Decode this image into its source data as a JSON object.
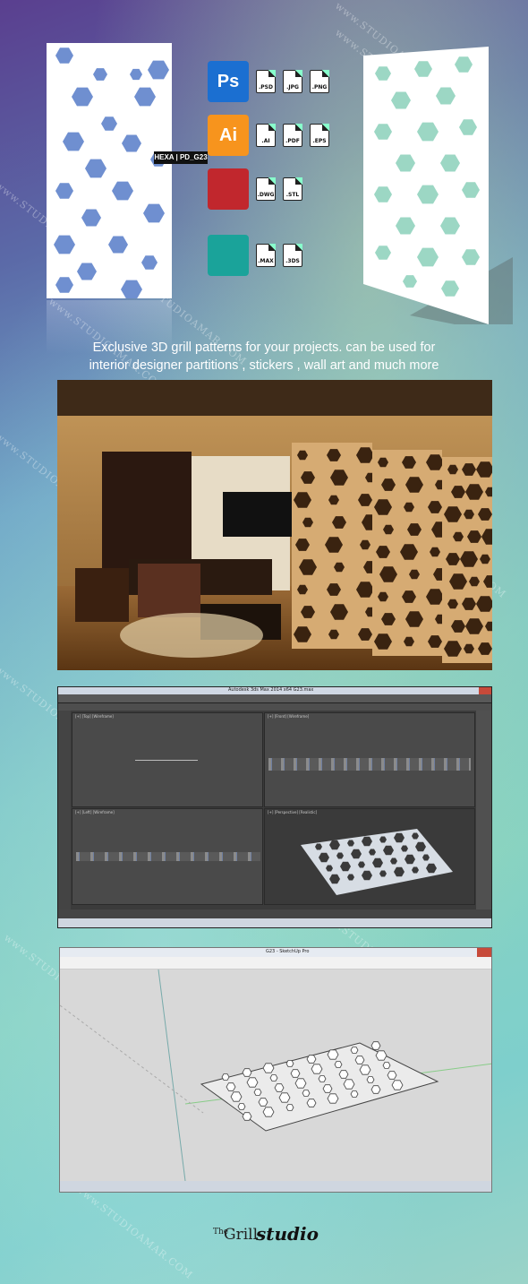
{
  "product_code": "HEXA | PD_G23",
  "watermark": "www.STUDIOAMAR.COM",
  "formats": [
    {
      "app": "ps-icon",
      "color": "#1b6fd1",
      "letters": "Ps",
      "files": [
        ".PSD",
        ".JPG",
        ".PNG"
      ]
    },
    {
      "app": "ai-icon",
      "color": "#f7941d",
      "letters": "Ai",
      "files": [
        ".AI",
        ".PDF",
        ".EPS"
      ]
    },
    {
      "app": "autocad-icon",
      "color": "#c1272d",
      "letters": "",
      "files": [
        ".DWG",
        ".STL"
      ]
    },
    {
      "app": "3dsmax-icon",
      "color": "#1aa39a",
      "letters": "",
      "files": [
        ".MAX",
        ".3DS"
      ]
    }
  ],
  "tagline": {
    "line1": "Exclusive  3D grill patterns for your projects.  can be used for",
    "line2": "interior designer partitions , stickers , wall art and much more"
  },
  "max_window": {
    "title": "Autodesk 3ds Max  2014 x64     G23.max"
  },
  "sketchup_window": {
    "title": "G23 - SketchUp Pro"
  },
  "logo": {
    "the": "The",
    "grill": "Grill",
    "studio": "studio"
  }
}
